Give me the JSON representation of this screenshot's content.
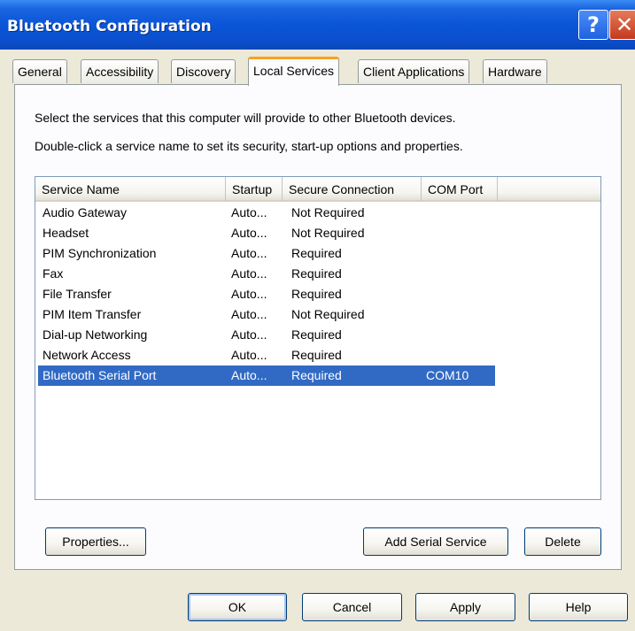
{
  "window": {
    "title": "Bluetooth Configuration"
  },
  "titlebar": {
    "help_glyph": "?",
    "close_glyph": "✕"
  },
  "tabs": [
    {
      "label": "General",
      "active": false
    },
    {
      "label": "Accessibility",
      "active": false
    },
    {
      "label": "Discovery",
      "active": false
    },
    {
      "label": "Local Services",
      "active": true
    },
    {
      "label": "Client Applications",
      "active": false
    },
    {
      "label": "Hardware",
      "active": false
    }
  ],
  "panel": {
    "description_1": "Select the services that this computer will provide to other Bluetooth devices.",
    "description_2": "Double-click a service name to set its security, start-up options and properties."
  },
  "table": {
    "columns": [
      "Service Name",
      "Startup",
      "Secure Connection",
      "COM Port"
    ],
    "rows": [
      {
        "name": "Audio Gateway",
        "startup": "Auto...",
        "secure": "Not Required",
        "com": ""
      },
      {
        "name": "Headset",
        "startup": "Auto...",
        "secure": "Not Required",
        "com": ""
      },
      {
        "name": "PIM Synchronization",
        "startup": "Auto...",
        "secure": "Required",
        "com": ""
      },
      {
        "name": "Fax",
        "startup": "Auto...",
        "secure": "Required",
        "com": ""
      },
      {
        "name": "File Transfer",
        "startup": "Auto...",
        "secure": "Required",
        "com": ""
      },
      {
        "name": "PIM Item Transfer",
        "startup": "Auto...",
        "secure": "Not Required",
        "com": ""
      },
      {
        "name": "Dial-up Networking",
        "startup": "Auto...",
        "secure": "Required",
        "com": ""
      },
      {
        "name": "Network Access",
        "startup": "Auto...",
        "secure": "Required",
        "com": ""
      },
      {
        "name": "Bluetooth Serial Port",
        "startup": "Auto...",
        "secure": "Required",
        "com": "COM10",
        "selected": true
      }
    ]
  },
  "panel_buttons": {
    "properties": "Properties...",
    "add_serial_service": "Add Serial Service",
    "delete": "Delete"
  },
  "dialog_buttons": {
    "ok": "OK",
    "cancel": "Cancel",
    "apply": "Apply",
    "help": "Help"
  },
  "colors": {
    "title_bar": "#0a55d8",
    "active_tab_accent": "#ff9f21",
    "selection": "#316ac5"
  }
}
